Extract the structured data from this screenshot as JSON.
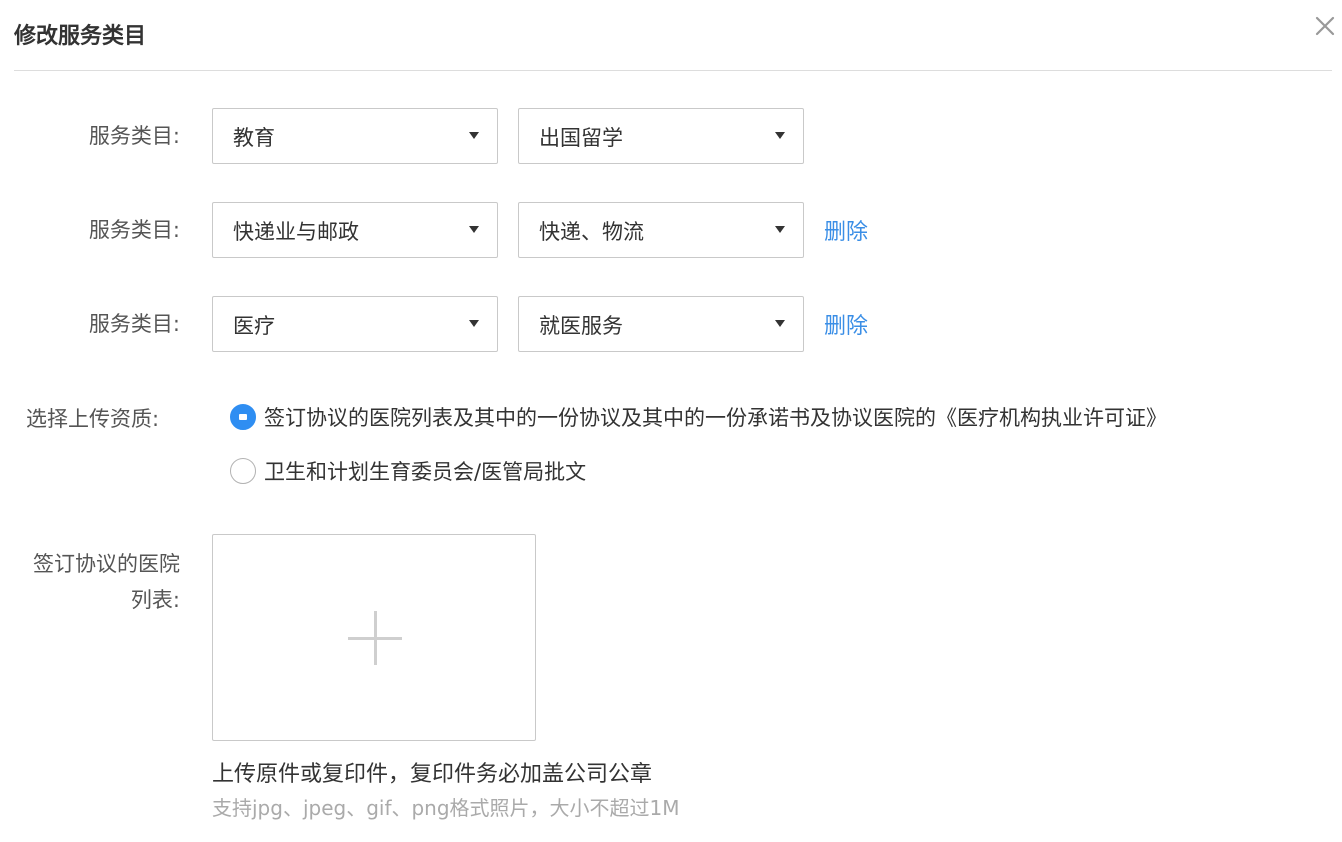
{
  "dialog": {
    "title": "修改服务类目",
    "close_icon": "close-icon"
  },
  "category_rows": [
    {
      "label": "服务类目:",
      "primary": "教育",
      "secondary": "出国留学",
      "delete_label": ""
    },
    {
      "label": "服务类目:",
      "primary": "快递业与邮政",
      "secondary": "快递、物流",
      "delete_label": "删除"
    },
    {
      "label": "服务类目:",
      "primary": "医疗",
      "secondary": "就医服务",
      "delete_label": "删除"
    }
  ],
  "qualification": {
    "label": "选择上传资质:",
    "options": [
      {
        "text": "签订协议的医院列表及其中的一份协议及其中的一份承诺书及协议医院的《医疗机构执业许可证》",
        "selected": true
      },
      {
        "text": "卫生和计划生育委员会/医管局批文",
        "selected": false
      }
    ]
  },
  "upload": {
    "label": "签订协议的医院列表:",
    "add_icon": "plus-icon",
    "hint": "上传原件或复印件，复印件务必加盖公司公章",
    "format_hint": "支持jpg、jpeg、gif、png格式照片，大小不超过1M"
  },
  "colors": {
    "link": "#3a8ee6",
    "radio_selected": "#2f8ef2",
    "border": "#c9c9c9"
  }
}
